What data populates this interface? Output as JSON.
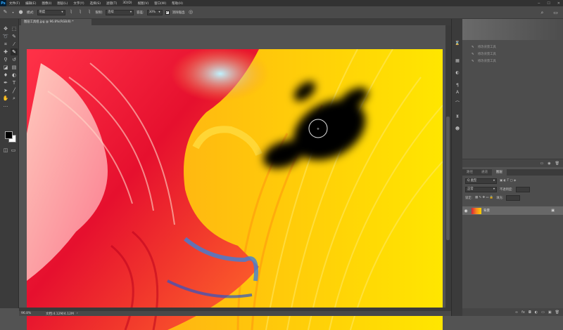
{
  "app": {
    "logo": "Ps"
  },
  "menu": [
    "文件(F)",
    "编辑(E)",
    "图像(I)",
    "图层(L)",
    "文字(Y)",
    "选择(S)",
    "滤镜(T)",
    "3D(D)",
    "视图(V)",
    "窗口(W)",
    "帮助(H)"
  ],
  "window_controls": {
    "min": "─",
    "max": "☐",
    "close": "✕"
  },
  "options": {
    "mode_label": "模式:",
    "mode_value": "明度",
    "sample_label": "限制:",
    "sample_value": "连续",
    "tolerance_label": "容差:",
    "tolerance_value": "30%",
    "antialias_label": "消除锯齿"
  },
  "document": {
    "tab": "图层工具组.jpg @ 96.8%(RGB/8) *",
    "close": "×"
  },
  "status": {
    "zoom": "96.8%",
    "doc_info": "文档:4.12M/4.12M",
    "arrow": "›"
  },
  "history": {
    "items": [
      "修改背景工具",
      "修改背景工具",
      "修改背景工具"
    ]
  },
  "layers": {
    "tabs": [
      "路径",
      "通道",
      "图层"
    ],
    "kind_label": "Q 类型",
    "blend": "正常",
    "opacity_label": "不透明度:",
    "lock_label": "锁定:",
    "fill_label": "填充:",
    "layer_name": "背景",
    "lock_icon": "🔒"
  },
  "colors": {
    "ui_dark": "#323232",
    "panel": "#535353",
    "canvas_yellow": "#ffd400"
  }
}
